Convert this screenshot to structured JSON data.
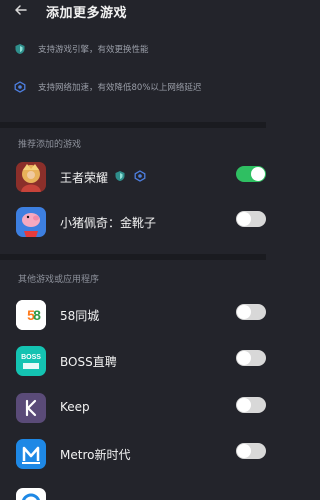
{
  "header": {
    "title": "添加更多游戏"
  },
  "info": [
    {
      "icon": "shield-icon",
      "text": "支持游戏引擎，有效更换性能"
    },
    {
      "icon": "network-icon",
      "text": "支持网络加速，有效降低80%以上网络延迟"
    }
  ],
  "sections": {
    "recommended_label": "推荐添加的游戏",
    "other_label": "其他游戏或应用程序"
  },
  "recommended": [
    {
      "name": "王者荣耀",
      "icon": "honor-of-kings-icon",
      "enabled": true,
      "badges": [
        "shield-badge-icon",
        "gear-badge-icon"
      ]
    },
    {
      "name": "小猪佩奇：金靴子",
      "icon": "peppa-pig-icon",
      "enabled": false
    }
  ],
  "others": [
    {
      "name": "58同城",
      "icon": "58-icon",
      "enabled": false
    },
    {
      "name": "BOSS直聘",
      "icon": "boss-icon",
      "enabled": false
    },
    {
      "name": "Keep",
      "icon": "keep-icon",
      "enabled": false
    },
    {
      "name": "Metro新时代",
      "icon": "metro-icon",
      "enabled": false
    }
  ],
  "colors": {
    "background": "#23242b",
    "toggle_on": "#2fbf62",
    "toggle_off": "#d8d8d8"
  }
}
